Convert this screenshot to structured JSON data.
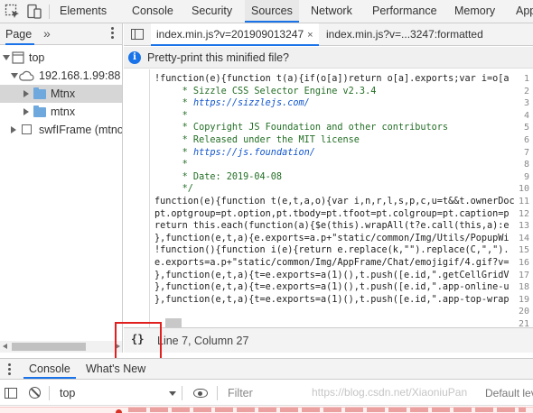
{
  "toolbar": {
    "tabs": [
      "Elements",
      "Console",
      "Security",
      "Sources",
      "Network",
      "Performance",
      "Memory",
      "App"
    ],
    "active_tab": "Sources"
  },
  "navigator": {
    "tab_label": "Page",
    "more_label": "»",
    "tree": [
      {
        "label": "top"
      },
      {
        "label": "192.168.1.99:88"
      },
      {
        "label": "Mtnx"
      },
      {
        "label": "mtnx"
      },
      {
        "label": "swfIFrame (mtnol"
      }
    ]
  },
  "editor": {
    "tabs": [
      {
        "label": "index.min.js?v=201909013247",
        "close": "×"
      },
      {
        "label": "index.min.js?v=...3247:formatted"
      }
    ],
    "infobar": {
      "icon": "i",
      "text": "Pretty-print this minified file?"
    },
    "line_numbers": [
      "1",
      "2",
      "3",
      "4",
      "5",
      "6",
      "7",
      "8",
      "9",
      "10",
      "11",
      "12",
      "13",
      "14",
      "15",
      "16",
      "17",
      "18",
      "19",
      "20",
      "21"
    ],
    "lines": [
      "!function(e){function t(a){if(o[a])return o[a].exports;var i=o[a",
      "     * Sizzle CSS Selector Engine v2.3.4",
      "     * https://sizzlejs.com/",
      "     *",
      "     * Copyright JS Foundation and other contributors",
      "     * Released under the MIT license",
      "     * https://js.foundation/",
      "     *",
      "     * Date: 2019-04-08",
      "     */",
      "function(e){function t(e,t,a,o){var i,n,r,l,s,p,c,u=t&&t.ownerDoc",
      "pt.optgroup=pt.option,pt.tbody=pt.tfoot=pt.colgroup=pt.caption=p",
      "return this.each(function(a){$e(this).wrapAll(t?e.call(this,a):e",
      "},function(e,t,a){e.exports=a.p+\"static/common/Img/Utils/PopupWi",
      "!function(){function i(e){return e.replace(k,\"\").replace(C,\",\").",
      "e.exports=a.p+\"static/common/Img/AppFrame/Chat/emojigif/4.gif?v=",
      "},function(e,t,a){t=e.exports=a(1)(),t.push([e.id,\".getCellGridV",
      "},function(e,t,a){t=e.exports=a(1)(),t.push([e.id,\".app-online-u",
      "},function(e,t,a){t=e.exports=a(1)(),t.push([e.id,\".app-top-wrap",
      "",
      ""
    ],
    "status": {
      "pretty_icon": "{}",
      "position": "Line 7, Column 27"
    }
  },
  "drawer": {
    "tabs": [
      "Console",
      "What's New"
    ],
    "active_tab": "Console",
    "context": "top",
    "filter_placeholder": "Filter",
    "levels": "Default lev"
  },
  "watermark": "https://blog.csdn.net/XiaoniuPan"
}
